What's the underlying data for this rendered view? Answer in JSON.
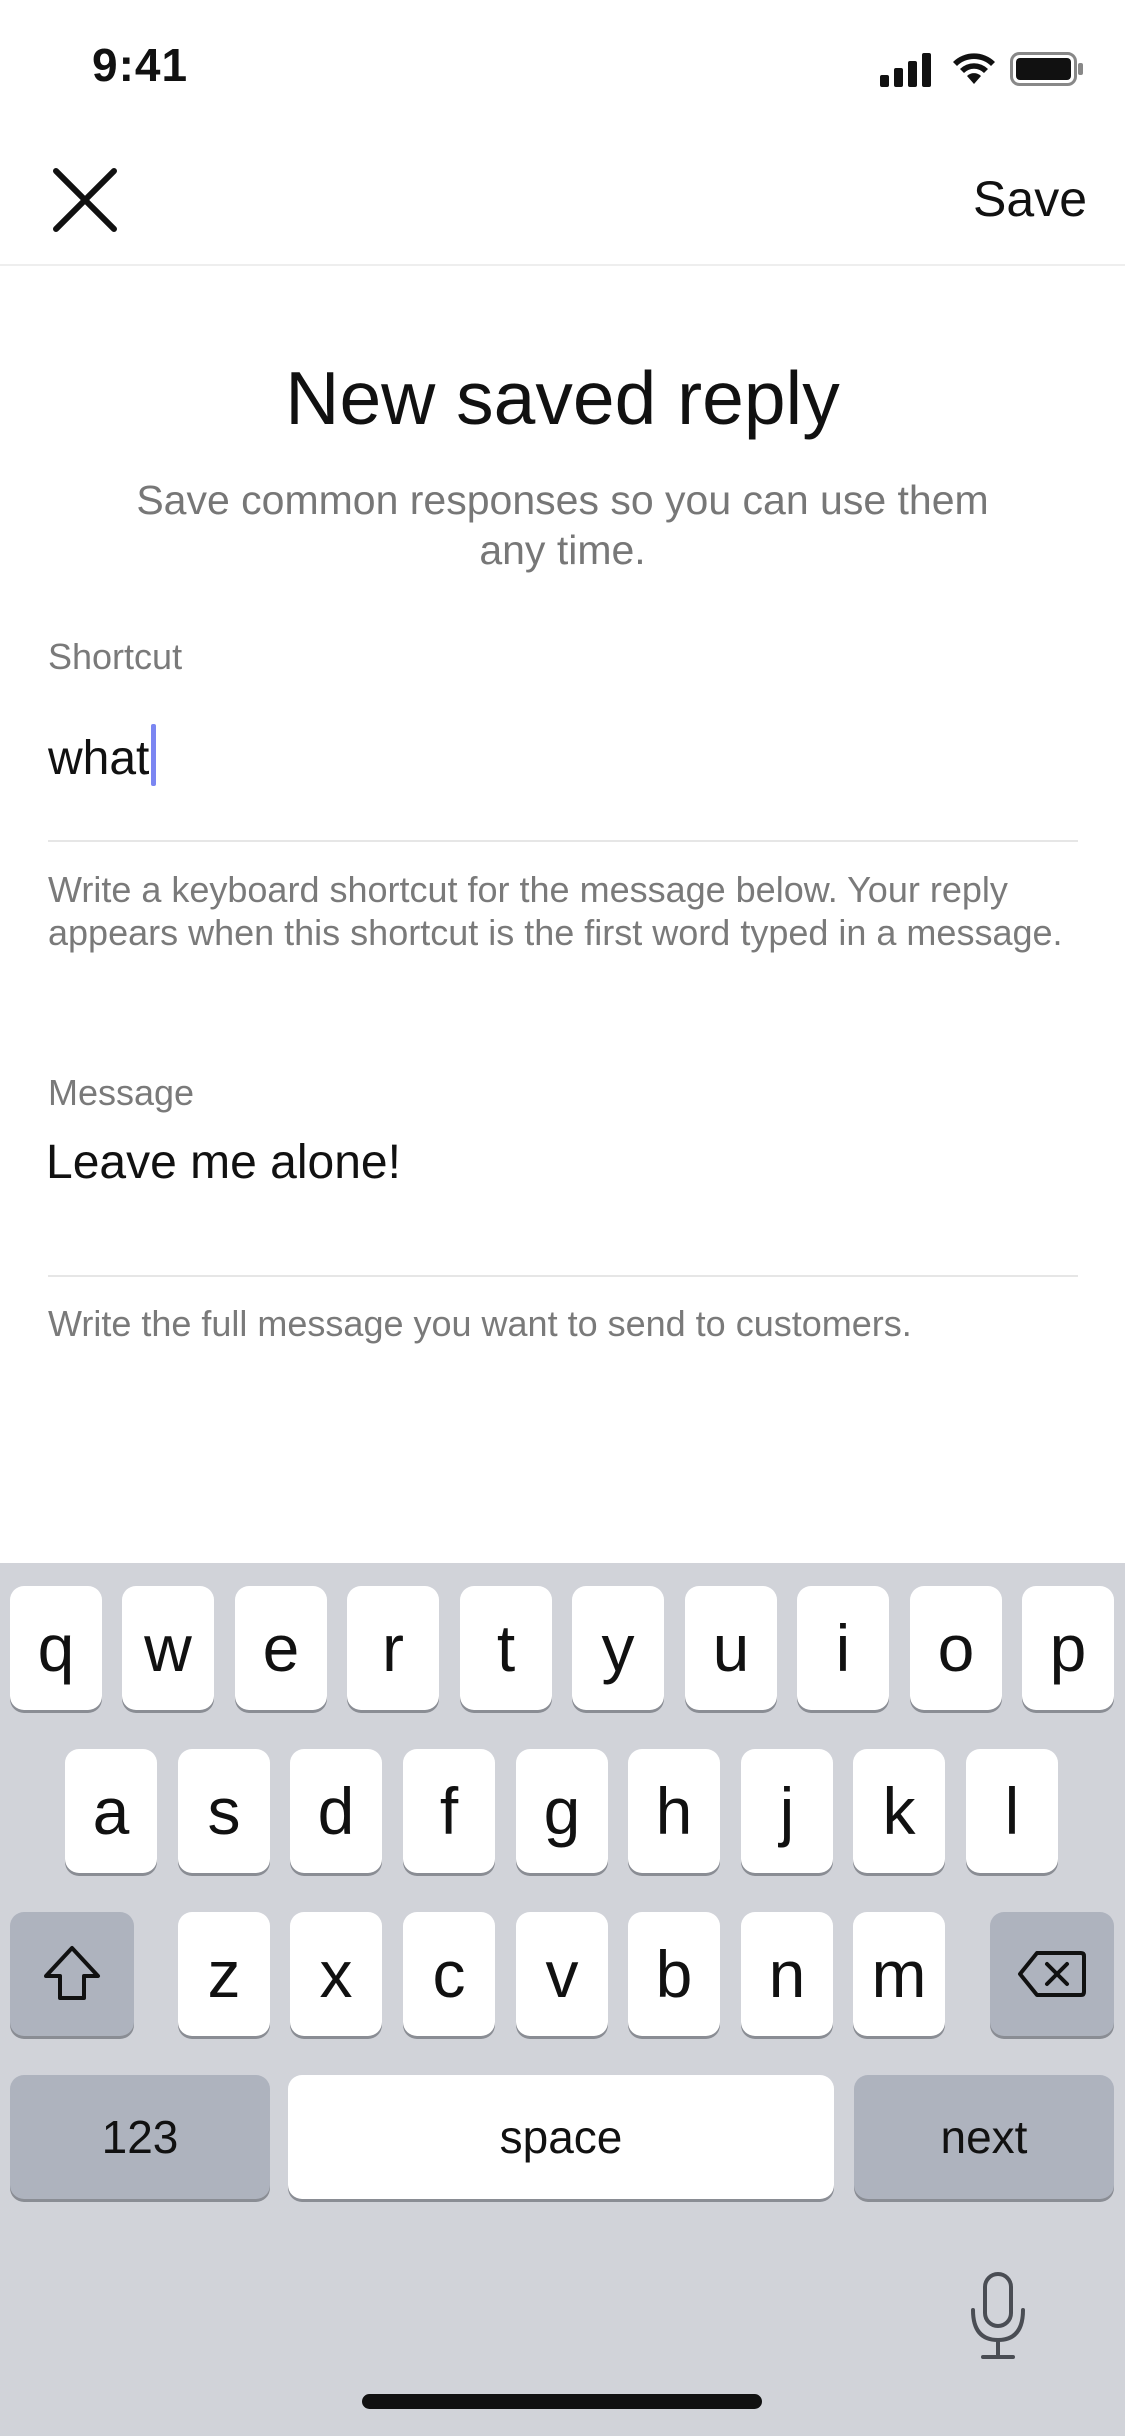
{
  "status_bar": {
    "time": "9:41"
  },
  "nav": {
    "save_label": "Save"
  },
  "header": {
    "title": "New saved reply",
    "subtitle": "Save common responses so you can use them any time."
  },
  "shortcut": {
    "label": "Shortcut",
    "value": "what",
    "help": "Write a keyboard shortcut for the message below. Your reply appears when this shortcut is the first word typed in a message."
  },
  "message": {
    "label": "Message",
    "value": "Leave me alone!",
    "help": "Write the full message you want to send to customers."
  },
  "keyboard": {
    "row1": [
      "q",
      "w",
      "e",
      "r",
      "t",
      "y",
      "u",
      "i",
      "o",
      "p"
    ],
    "row2": [
      "a",
      "s",
      "d",
      "f",
      "g",
      "h",
      "j",
      "k",
      "l"
    ],
    "row3": [
      "z",
      "x",
      "c",
      "v",
      "b",
      "n",
      "m"
    ],
    "numbers_label": "123",
    "space_label": "space",
    "next_label": "next"
  },
  "icons": {
    "close": "close-icon",
    "shift": "shift-icon",
    "backspace": "backspace-icon",
    "microphone": "microphone-icon",
    "signal": "cellular-signal-icon",
    "wifi": "wifi-icon",
    "battery": "battery-icon"
  },
  "colors": {
    "cursor": "#7b86f2",
    "keyboard_bg": "#d1d3d9",
    "dark_key": "#aeb3be"
  }
}
